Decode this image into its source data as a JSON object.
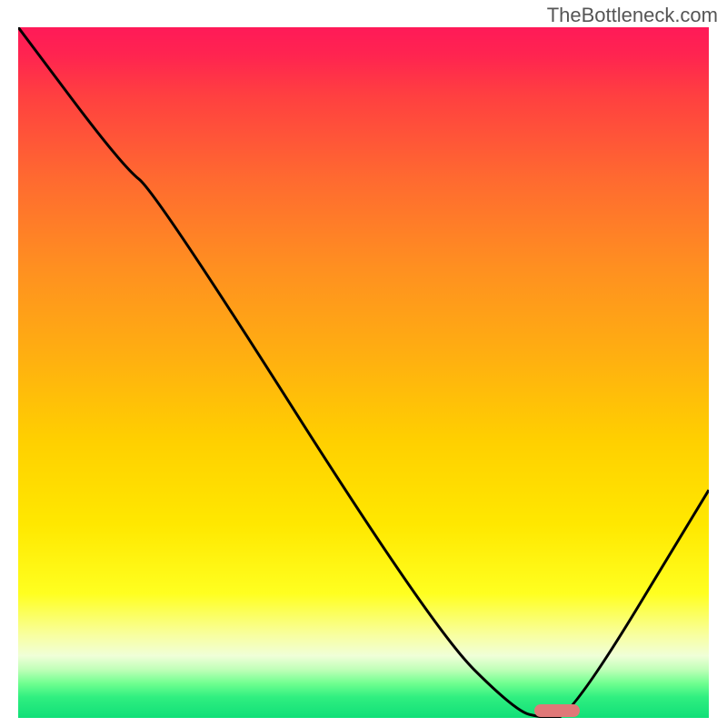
{
  "watermark": "TheBottleneck.com",
  "chart_data": {
    "type": "line",
    "title": "",
    "xlabel": "",
    "ylabel": "",
    "xlim": [
      0,
      100
    ],
    "ylim": [
      0,
      100
    ],
    "grid": false,
    "background": "gradient-red-to-green",
    "series": [
      {
        "name": "bottleneck-curve",
        "x": [
          0,
          15,
          20,
          60,
          72,
          76,
          80,
          100
        ],
        "values": [
          100,
          80,
          76,
          13,
          1,
          0,
          0,
          33
        ]
      }
    ],
    "marker": {
      "x": 78,
      "y": 1,
      "shape": "pill",
      "color": "#e07878"
    },
    "colors": {
      "top": "#ff1a58",
      "mid": "#ffd000",
      "bottom": "#10df78",
      "line": "#000000"
    }
  }
}
